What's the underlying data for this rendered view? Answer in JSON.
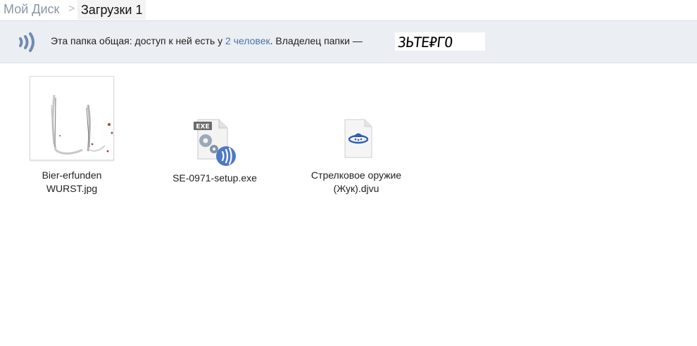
{
  "breadcrumb": {
    "root": "Мой Диск",
    "separator": ">",
    "current": "Загрузки 1"
  },
  "share_bar": {
    "text_before": "Эта папка общая: доступ к ней есть у ",
    "people_link": "2 человек",
    "text_after": ". Владелец папки — ",
    "owner_signature": "ЗЬТЕ₽ГО",
    "icon": "shared-folder-icon"
  },
  "files": [
    {
      "name_line1": "Bier-erfunden",
      "name_line2": "WURST.jpg",
      "icon": "image-thumbnail"
    },
    {
      "name_line1": "SE-0971-setup.exe",
      "name_line2": "",
      "icon": "exe-file-icon",
      "badge": "EXE"
    },
    {
      "name_line1": "Стрелковое оружие",
      "name_line2": "(Жук).djvu",
      "icon": "djvu-file-icon"
    }
  ],
  "colors": {
    "link": "#4a76a8",
    "bar_bg": "#ebeef2",
    "share_icon": "#6f8bb0"
  }
}
